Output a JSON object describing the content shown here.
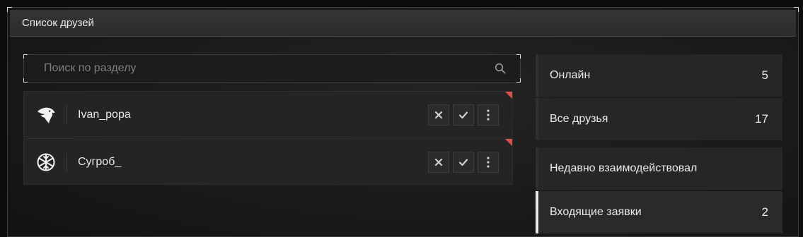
{
  "window": {
    "title": "Список друзей"
  },
  "search": {
    "placeholder": "Поиск по разделу",
    "value": ""
  },
  "friends": [
    {
      "name": "Ivan_popa",
      "avatar_icon": "eagle-icon",
      "new_indicator": true
    },
    {
      "name": "Сугроб_",
      "avatar_icon": "snowflake-icon",
      "new_indicator": true
    }
  ],
  "categories": [
    {
      "label": "Онлайн",
      "count": "5"
    },
    {
      "label": "Все друзья",
      "count": "17"
    },
    {
      "label": "Недавно взаимодействовал",
      "count": ""
    },
    {
      "label": "Входящие заявки",
      "count": "2",
      "active": true
    }
  ],
  "colors": {
    "accent_flag": "#d9524f",
    "active_marker": "#e8e8e8",
    "panel": "#242424",
    "background": "#1a1a1a"
  }
}
